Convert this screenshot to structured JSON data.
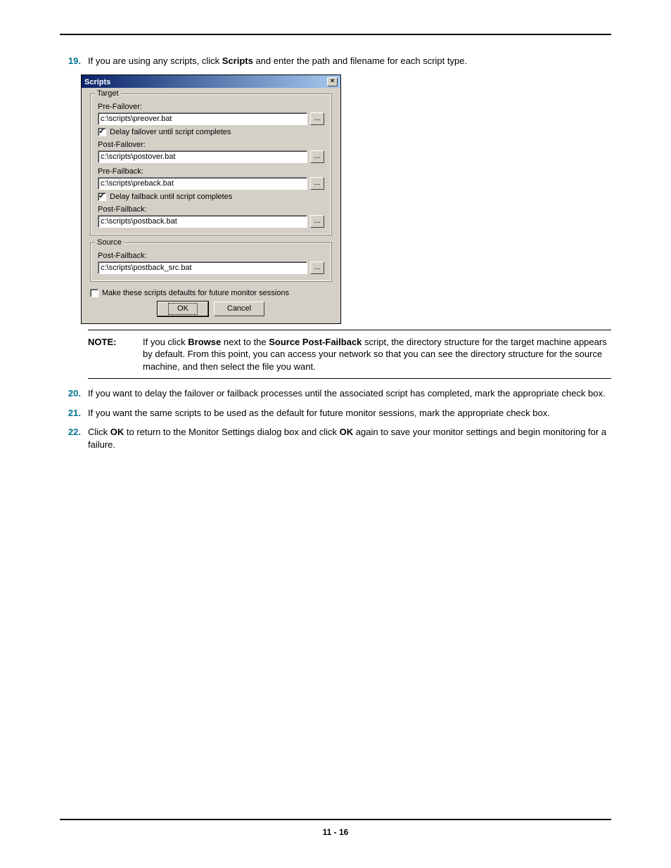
{
  "step19": {
    "num": "19.",
    "pre": "If you are using any scripts, click ",
    "bold": "Scripts",
    "post": " and enter the path and filename for each script type."
  },
  "dialog": {
    "title": "Scripts",
    "close": "×",
    "target_legend": "Target",
    "source_legend": "Source",
    "pre_failover_label": "Pre-Failover:",
    "pre_failover_value": "c:\\scripts\\preover.bat",
    "delay_failover_label": "Delay failover until script completes",
    "post_failover_label": "Post-Failover:",
    "post_failover_value": "c:\\scripts\\postover.bat",
    "pre_failback_label": "Pre-Failback:",
    "pre_failback_value": "c:\\scripts\\preback.bat",
    "delay_failback_label": "Delay failback until script completes",
    "post_failback_label": "Post-Failback:",
    "post_failback_value": "c:\\scripts\\postback.bat",
    "src_post_failback_label": "Post-Failback:",
    "src_post_failback_value": "c:\\scripts\\postback_src.bat",
    "make_default_label": "Make these scripts defaults for future monitor sessions",
    "ok": "OK",
    "cancel": "Cancel",
    "browse": "..."
  },
  "note": {
    "label": "NOTE:",
    "pre": "If you click ",
    "b1": "Browse",
    "mid1": " next to the ",
    "b2": "Source Post-Failback",
    "post": " script, the directory structure for the target machine appears by default. From this point, you can access your network so that you can see the directory structure for the source machine, and then select the file you want."
  },
  "step20": {
    "num": "20.",
    "text": "If you want to delay the failover or failback processes until the associated script has completed, mark the appropriate check box."
  },
  "step21": {
    "num": "21.",
    "text": "If you want the same scripts to be used as the default for future monitor sessions, mark the appropriate check box."
  },
  "step22": {
    "num": "22.",
    "pre": "Click ",
    "b1": "OK",
    "mid": " to return to the Monitor Settings dialog box and click ",
    "b2": "OK",
    "post": " again to save your monitor settings and begin monitoring for a failure."
  },
  "page_number": "11 - 16"
}
